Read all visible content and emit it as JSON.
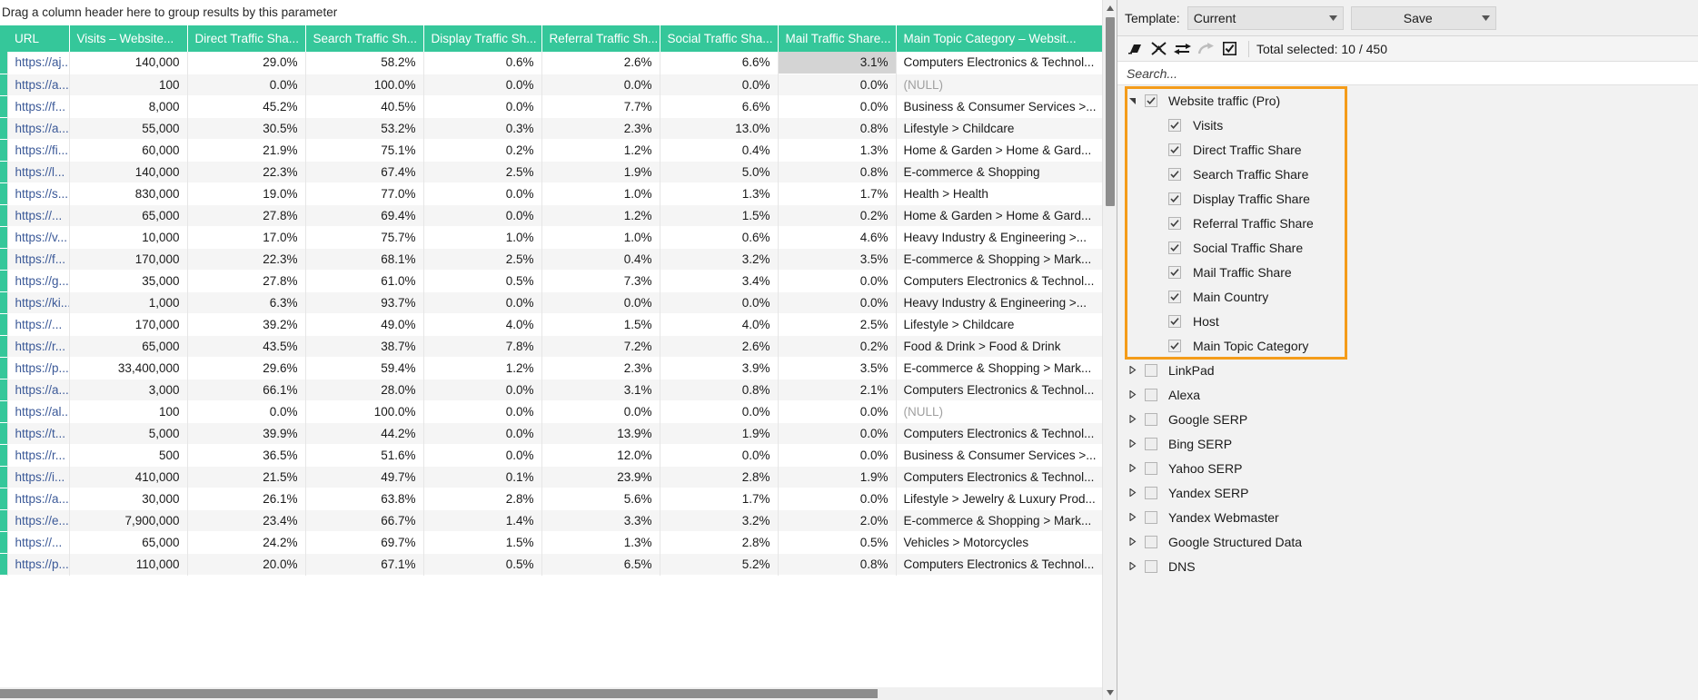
{
  "grid": {
    "group_panel_hint": "Drag a column header here to group results by this parameter",
    "columns": [
      "URL",
      "Visits  –  Website...",
      "Direct Traffic Sha...",
      "Search Traffic Sh...",
      "Display Traffic Sh...",
      "Referral Traffic Sh...",
      "Social Traffic Sha...",
      "Mail Traffic Share...",
      "Main Topic Category  –  Websit..."
    ],
    "rows": [
      {
        "url": "https://aj...",
        "visits": "140,000",
        "direct": "29.0%",
        "search": "58.2%",
        "display": "0.6%",
        "referral": "2.6%",
        "social": "6.6%",
        "mail": "3.1%",
        "category": "Computers Electronics & Technol...",
        "mail_highlight": true
      },
      {
        "url": "https://a...",
        "visits": "100",
        "direct": "0.0%",
        "search": "100.0%",
        "display": "0.0%",
        "referral": "0.0%",
        "social": "0.0%",
        "mail": "0.0%",
        "category": "(NULL)",
        "category_null": true
      },
      {
        "url": "https://f...",
        "visits": "8,000",
        "direct": "45.2%",
        "search": "40.5%",
        "display": "0.0%",
        "referral": "7.7%",
        "social": "6.6%",
        "mail": "0.0%",
        "category": "Business & Consumer Services >..."
      },
      {
        "url": "https://a...",
        "visits": "55,000",
        "direct": "30.5%",
        "search": "53.2%",
        "display": "0.3%",
        "referral": "2.3%",
        "social": "13.0%",
        "mail": "0.8%",
        "category": "Lifestyle > Childcare"
      },
      {
        "url": "https://fi...",
        "visits": "60,000",
        "direct": "21.9%",
        "search": "75.1%",
        "display": "0.2%",
        "referral": "1.2%",
        "social": "0.4%",
        "mail": "1.3%",
        "category": "Home & Garden > Home & Gard..."
      },
      {
        "url": "https://l...",
        "visits": "140,000",
        "direct": "22.3%",
        "search": "67.4%",
        "display": "2.5%",
        "referral": "1.9%",
        "social": "5.0%",
        "mail": "0.8%",
        "category": "E-commerce & Shopping"
      },
      {
        "url": "https://s...",
        "visits": "830,000",
        "direct": "19.0%",
        "search": "77.0%",
        "display": "0.0%",
        "referral": "1.0%",
        "social": "1.3%",
        "mail": "1.7%",
        "category": "Health > Health"
      },
      {
        "url": "https://...",
        "visits": "65,000",
        "direct": "27.8%",
        "search": "69.4%",
        "display": "0.0%",
        "referral": "1.2%",
        "social": "1.5%",
        "mail": "0.2%",
        "category": "Home & Garden > Home & Gard..."
      },
      {
        "url": "https://v...",
        "visits": "10,000",
        "direct": "17.0%",
        "search": "75.7%",
        "display": "1.0%",
        "referral": "1.0%",
        "social": "0.6%",
        "mail": "4.6%",
        "category": "Heavy Industry & Engineering >..."
      },
      {
        "url": "https://f...",
        "visits": "170,000",
        "direct": "22.3%",
        "search": "68.1%",
        "display": "2.5%",
        "referral": "0.4%",
        "social": "3.2%",
        "mail": "3.5%",
        "category": "E-commerce & Shopping > Mark..."
      },
      {
        "url": "https://g...",
        "visits": "35,000",
        "direct": "27.8%",
        "search": "61.0%",
        "display": "0.5%",
        "referral": "7.3%",
        "social": "3.4%",
        "mail": "0.0%",
        "category": "Computers Electronics & Technol..."
      },
      {
        "url": "https://ki...",
        "visits": "1,000",
        "direct": "6.3%",
        "search": "93.7%",
        "display": "0.0%",
        "referral": "0.0%",
        "social": "0.0%",
        "mail": "0.0%",
        "category": "Heavy Industry & Engineering >..."
      },
      {
        "url": "https://...",
        "visits": "170,000",
        "direct": "39.2%",
        "search": "49.0%",
        "display": "4.0%",
        "referral": "1.5%",
        "social": "4.0%",
        "mail": "2.5%",
        "category": "Lifestyle > Childcare"
      },
      {
        "url": "https://r...",
        "visits": "65,000",
        "direct": "43.5%",
        "search": "38.7%",
        "display": "7.8%",
        "referral": "7.2%",
        "social": "2.6%",
        "mail": "0.2%",
        "category": "Food & Drink > Food & Drink"
      },
      {
        "url": "https://p...",
        "visits": "33,400,000",
        "direct": "29.6%",
        "search": "59.4%",
        "display": "1.2%",
        "referral": "2.3%",
        "social": "3.9%",
        "mail": "3.5%",
        "category": "E-commerce & Shopping > Mark..."
      },
      {
        "url": "https://a...",
        "visits": "3,000",
        "direct": "66.1%",
        "search": "28.0%",
        "display": "0.0%",
        "referral": "3.1%",
        "social": "0.8%",
        "mail": "2.1%",
        "category": "Computers Electronics & Technol..."
      },
      {
        "url": "https://al...",
        "visits": "100",
        "direct": "0.0%",
        "search": "100.0%",
        "display": "0.0%",
        "referral": "0.0%",
        "social": "0.0%",
        "mail": "0.0%",
        "category": "(NULL)",
        "category_null": true
      },
      {
        "url": "https://t...",
        "visits": "5,000",
        "direct": "39.9%",
        "search": "44.2%",
        "display": "0.0%",
        "referral": "13.9%",
        "social": "1.9%",
        "mail": "0.0%",
        "category": "Computers Electronics & Technol..."
      },
      {
        "url": "https://r...",
        "visits": "500",
        "direct": "36.5%",
        "search": "51.6%",
        "display": "0.0%",
        "referral": "12.0%",
        "social": "0.0%",
        "mail": "0.0%",
        "category": "Business & Consumer Services >..."
      },
      {
        "url": "https://i...",
        "visits": "410,000",
        "direct": "21.5%",
        "search": "49.7%",
        "display": "0.1%",
        "referral": "23.9%",
        "social": "2.8%",
        "mail": "1.9%",
        "category": "Computers Electronics & Technol..."
      },
      {
        "url": "https://a...",
        "visits": "30,000",
        "direct": "26.1%",
        "search": "63.8%",
        "display": "2.8%",
        "referral": "5.6%",
        "social": "1.7%",
        "mail": "0.0%",
        "category": "Lifestyle > Jewelry & Luxury Prod..."
      },
      {
        "url": "https://e...",
        "visits": "7,900,000",
        "direct": "23.4%",
        "search": "66.7%",
        "display": "1.4%",
        "referral": "3.3%",
        "social": "3.2%",
        "mail": "2.0%",
        "category": "E-commerce & Shopping > Mark..."
      },
      {
        "url": "https://...",
        "visits": "65,000",
        "direct": "24.2%",
        "search": "69.7%",
        "display": "1.5%",
        "referral": "1.3%",
        "social": "2.8%",
        "mail": "0.5%",
        "category": "Vehicles > Motorcycles"
      },
      {
        "url": "https://p...",
        "visits": "110,000",
        "direct": "20.0%",
        "search": "67.1%",
        "display": "0.5%",
        "referral": "6.5%",
        "social": "5.2%",
        "mail": "0.8%",
        "category": "Computers Electronics & Technol..."
      }
    ]
  },
  "panel": {
    "template_label": "Template:",
    "template_value": "Current",
    "save_label": "Save",
    "total_selected": "Total selected: 10 / 450",
    "search_placeholder": "Search...",
    "search_value": "",
    "toolbar_icons": [
      {
        "name": "eraser-icon",
        "disabled": false
      },
      {
        "name": "collapse-icon",
        "disabled": false
      },
      {
        "name": "swap-arrows-icon",
        "disabled": false
      },
      {
        "name": "redo-arrow-icon",
        "disabled": true
      },
      {
        "name": "checkbox-select-icon",
        "disabled": false
      }
    ],
    "tree": [
      {
        "label": "Website traffic (Pro)",
        "checked": true,
        "level": 0,
        "expanded": true,
        "highlighted": true
      },
      {
        "label": "Visits",
        "checked": true,
        "level": 1,
        "highlighted": true
      },
      {
        "label": "Direct Traffic Share",
        "checked": true,
        "level": 1,
        "highlighted": true
      },
      {
        "label": "Search Traffic Share",
        "checked": true,
        "level": 1,
        "highlighted": true
      },
      {
        "label": "Display Traffic Share",
        "checked": true,
        "level": 1,
        "highlighted": true
      },
      {
        "label": "Referral Traffic Share",
        "checked": true,
        "level": 1,
        "highlighted": true
      },
      {
        "label": "Social Traffic Share",
        "checked": true,
        "level": 1,
        "highlighted": true
      },
      {
        "label": "Mail Traffic Share",
        "checked": true,
        "level": 1,
        "highlighted": true
      },
      {
        "label": "Main Country",
        "checked": true,
        "level": 1,
        "highlighted": true
      },
      {
        "label": "Host",
        "checked": true,
        "level": 1,
        "highlighted": true
      },
      {
        "label": "Main Topic Category",
        "checked": true,
        "level": 1,
        "highlighted": true
      },
      {
        "label": "LinkPad",
        "checked": false,
        "level": 0,
        "expanded": false
      },
      {
        "label": "Alexa",
        "checked": false,
        "level": 0,
        "expanded": false
      },
      {
        "label": "Google SERP",
        "checked": false,
        "level": 0,
        "expanded": false
      },
      {
        "label": "Bing SERP",
        "checked": false,
        "level": 0,
        "expanded": false
      },
      {
        "label": "Yahoo SERP",
        "checked": false,
        "level": 0,
        "expanded": false
      },
      {
        "label": "Yandex SERP",
        "checked": false,
        "level": 0,
        "expanded": false
      },
      {
        "label": "Yandex Webmaster",
        "checked": false,
        "level": 0,
        "expanded": false
      },
      {
        "label": "Google Structured Data",
        "checked": false,
        "level": 0,
        "expanded": false
      },
      {
        "label": "DNS",
        "checked": false,
        "level": 0,
        "expanded": false
      }
    ]
  },
  "colors": {
    "header_green": "#35c79a",
    "highlight_orange": "#f49c1a",
    "link_blue": "#3b5998",
    "selected_cell_gray": "#d4d4d4"
  }
}
